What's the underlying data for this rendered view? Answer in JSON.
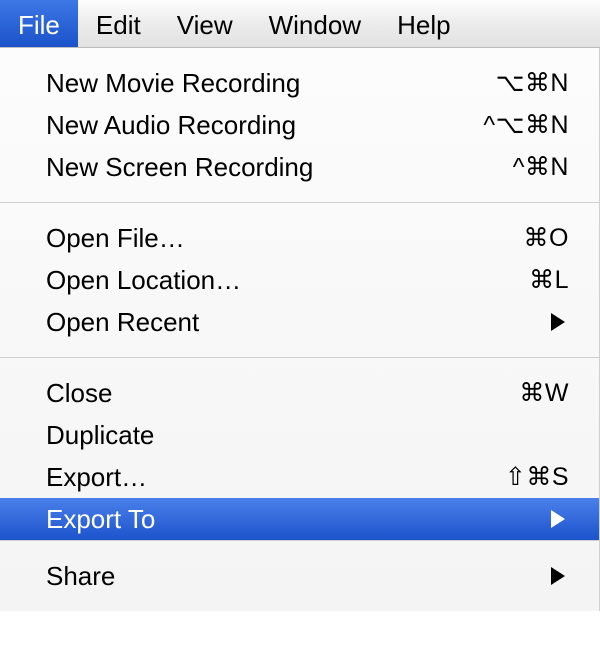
{
  "menubar": {
    "file": "File",
    "edit": "Edit",
    "view": "View",
    "window": "Window",
    "help": "Help"
  },
  "dropdown": {
    "new_movie": {
      "label": "New Movie Recording",
      "shortcut": "⌥⌘N"
    },
    "new_audio": {
      "label": "New Audio Recording",
      "shortcut": "^⌥⌘N"
    },
    "new_screen": {
      "label": "New Screen Recording",
      "shortcut": "^⌘N"
    },
    "open_file": {
      "label": "Open File…",
      "shortcut": "⌘O"
    },
    "open_loc": {
      "label": "Open Location…",
      "shortcut": "⌘L"
    },
    "open_recent": {
      "label": "Open Recent"
    },
    "close": {
      "label": "Close",
      "shortcut": "⌘W"
    },
    "duplicate": {
      "label": "Duplicate"
    },
    "export": {
      "label": "Export…",
      "shortcut": "⇧⌘S"
    },
    "export_to": {
      "label": "Export To"
    },
    "share": {
      "label": "Share"
    }
  }
}
